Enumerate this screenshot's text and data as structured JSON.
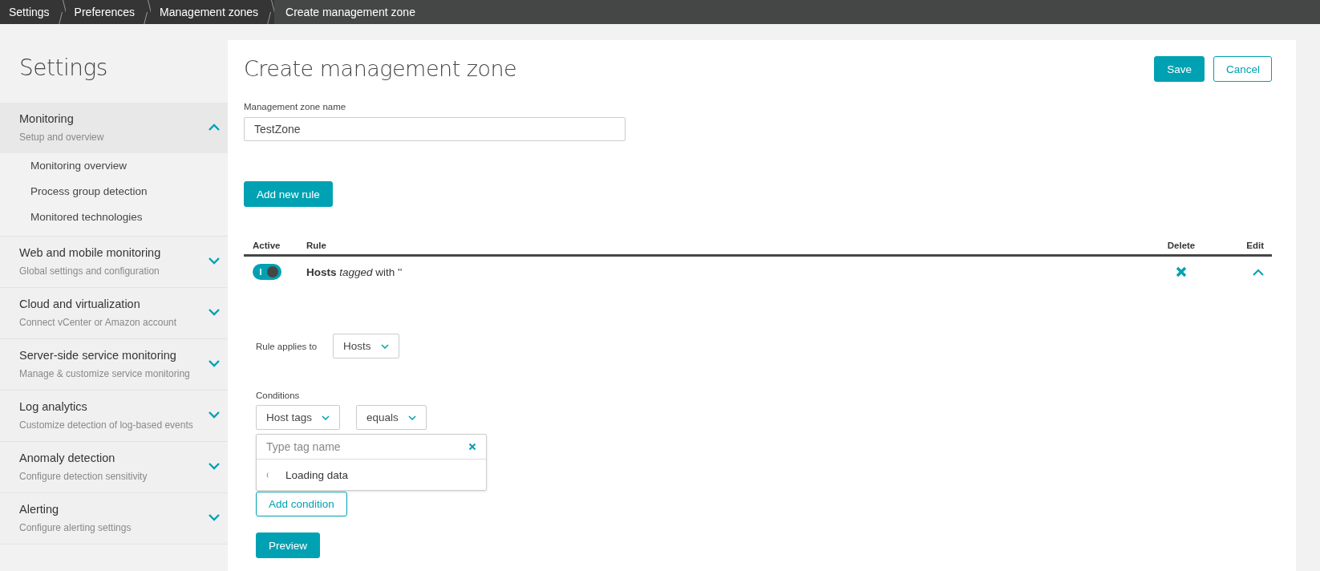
{
  "breadcrumbs": [
    {
      "label": "Settings"
    },
    {
      "label": "Preferences"
    },
    {
      "label": "Management zones"
    },
    {
      "label": "Create management zone"
    }
  ],
  "sidebar": {
    "title": "Settings",
    "sections": [
      {
        "title": "Monitoring",
        "subtitle": "Setup and overview",
        "expanded": true,
        "items": [
          "Monitoring overview",
          "Process group detection",
          "Monitored technologies"
        ]
      },
      {
        "title": "Web and mobile monitoring",
        "subtitle": "Global settings and configuration",
        "expanded": false
      },
      {
        "title": "Cloud and virtualization",
        "subtitle": "Connect vCenter or Amazon account",
        "expanded": false
      },
      {
        "title": "Server-side service monitoring",
        "subtitle": "Manage & customize service monitoring",
        "expanded": false
      },
      {
        "title": "Log analytics",
        "subtitle": "Customize detection of log-based events",
        "expanded": false
      },
      {
        "title": "Anomaly detection",
        "subtitle": "Configure detection sensitivity",
        "expanded": false
      },
      {
        "title": "Alerting",
        "subtitle": "Configure alerting settings",
        "expanded": false
      }
    ]
  },
  "page": {
    "title": "Create management zone",
    "save_button": "Save",
    "cancel_button": "Cancel",
    "name_field": {
      "label": "Management zone name",
      "value": "TestZone"
    },
    "add_rule_button": "Add new rule",
    "table": {
      "columns": [
        "Active",
        "Rule",
        "Delete",
        "Edit"
      ],
      "rules": [
        {
          "active": true,
          "text": "**Hosts** *tagged* with ''",
          "expanded": true,
          "editor": {
            "applies_label": "Rule applies to",
            "applies_value": "Hosts",
            "conditions_label": "Conditions",
            "key_value": "Host tags",
            "operator_value": "equals",
            "tag_placeholder": "Type tag name",
            "suggestion": "Loading data",
            "add_condition_button": "Add condition",
            "preview_button": "Preview"
          }
        }
      ]
    }
  }
}
